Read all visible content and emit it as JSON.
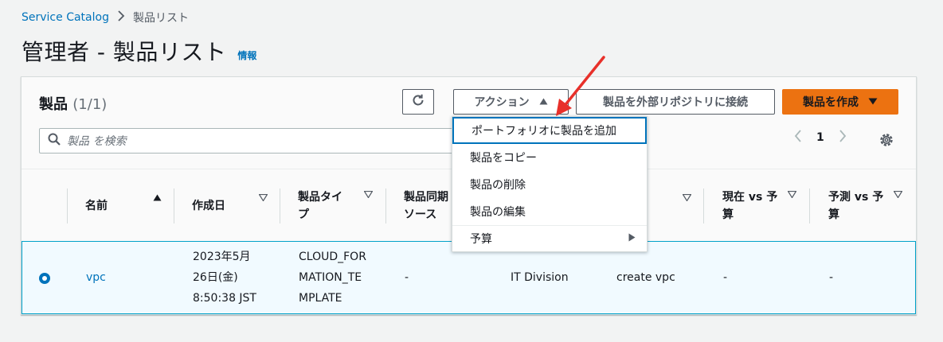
{
  "breadcrumb": {
    "root": "Service Catalog",
    "current": "製品リスト"
  },
  "page": {
    "title": "管理者 - 製品リスト",
    "info": "情報"
  },
  "panel": {
    "title": "製品",
    "count": "(1/1)",
    "search_placeholder": "製品 を検索",
    "page_number": "1"
  },
  "toolbar": {
    "actions_label": "アクション",
    "connect_label": "製品を外部リポジトリに接続",
    "create_label": "製品を作成"
  },
  "dropdown": {
    "items": [
      "ポートフォリオに製品を追加",
      "製品をコピー",
      "製品の削除",
      "製品の編集",
      "予算"
    ]
  },
  "table": {
    "columns": [
      "名前",
      "作成日",
      "製品タイプ",
      "製品同期ソース",
      "現在 vs 予算",
      "予測 vs 予算"
    ],
    "column_lines": {
      "type": [
        "製品タイ",
        "プ"
      ],
      "sync": [
        "製品同期",
        "ソース"
      ],
      "current": [
        "現在 vs 予",
        "算"
      ],
      "forecast": [
        "予測 vs 予",
        "算"
      ]
    },
    "rows": [
      {
        "name": "vpc",
        "created_lines": [
          "2023年5月",
          "26日(金)",
          "8:50:38 JST"
        ],
        "type_lines": [
          "CLOUD_FOR",
          "MATION_TE",
          "MPLATE"
        ],
        "sync": "-",
        "owner": "IT Division",
        "description": "create vpc",
        "current": "-",
        "forecast": "-"
      }
    ]
  },
  "colors": {
    "link": "#0073bb",
    "primary": "#ec7211",
    "selected_row": "#f1faff",
    "arrow": "#e8302a"
  }
}
